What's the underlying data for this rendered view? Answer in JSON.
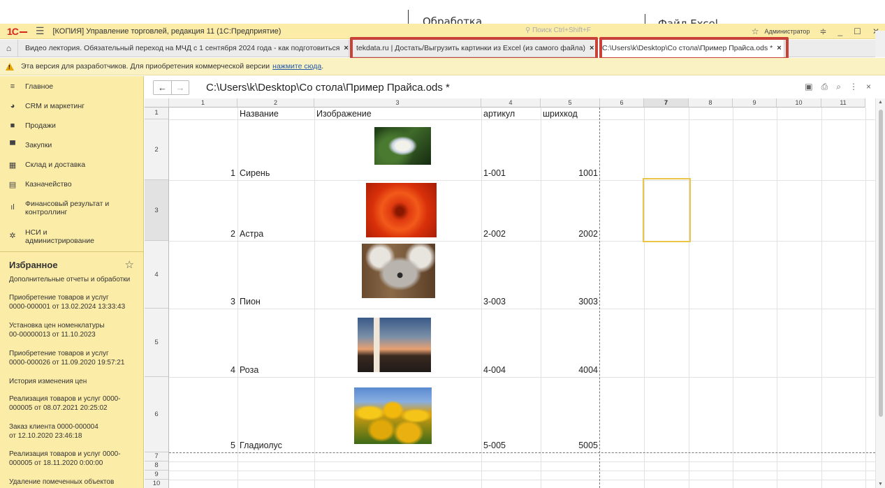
{
  "annotations": {
    "processing": "Обработка",
    "excel_file": "Файл Excel"
  },
  "titlebar": {
    "logo": "1С",
    "title": "[КОПИЯ] Управление торговлей, редакция 11  (1С:Предприятие)",
    "search_placeholder": "Поиск Ctrl+Shift+F",
    "user": "Администратор"
  },
  "tabs": [
    {
      "label": "Видео лектория. Обязательный переход на МЧД с 1 сентября 2024 года - как подготовиться"
    },
    {
      "label": "tekdata.ru | Достать/Выгрузить картинки из Excel (из самого файла)"
    },
    {
      "label": "C:\\Users\\k\\Desktop\\Со стола\\Пример Прайса.ods *"
    }
  ],
  "warning": {
    "text": "Эта версия для разработчиков. Для приобретения коммерческой версии",
    "link": "нажмите сюда",
    "suffix": "."
  },
  "sidebar": {
    "nav": [
      {
        "icon": "menu-icon",
        "label": "Главное"
      },
      {
        "icon": "crm-icon",
        "label": "CRM и маркетинг"
      },
      {
        "icon": "bag-icon",
        "label": "Продажи"
      },
      {
        "icon": "cart-icon",
        "label": "Закупки"
      },
      {
        "icon": "warehouse-icon",
        "label": "Склад и доставка"
      },
      {
        "icon": "treasury-icon",
        "label": "Казначейство"
      },
      {
        "icon": "chart-icon",
        "label": "Финансовый результат и контроллинг"
      },
      {
        "icon": "gear-icon",
        "label": "НСИ и администрирование"
      }
    ],
    "favorites_title": "Избранное",
    "favorites": [
      "Дополнительные отчеты и обработки",
      "Приобретение товаров и услуг 0000-000001 от 13.02.2024 13:33:43",
      "Установка цен номенклатуры 00-00000013 от 11.10.2023",
      "Приобретение товаров и услуг 0000-000026 от 11.09.2020 19:57:21",
      "История изменения цен",
      "Реализация товаров и услуг 0000-000005 от 08.07.2021 20:25:02",
      "Заказ клиента 0000-000004 от 12.10.2020 23:46:18",
      "Реализация товаров и услуг 0000-000005 от 18.11.2020 0:00:00",
      "Удаление помеченных объектов"
    ]
  },
  "document": {
    "title": "C:\\Users\\k\\Desktop\\Со стола\\Пример Прайса.ods *"
  },
  "sheet": {
    "columns": [
      "1",
      "2",
      "3",
      "4",
      "5",
      "6",
      "7",
      "8",
      "9",
      "10",
      "11"
    ],
    "rows": [
      "1",
      "2",
      "3",
      "4",
      "5",
      "6",
      "7",
      "8",
      "9",
      "10"
    ],
    "selected_column": "7",
    "selected_row": "3",
    "headers": {
      "name": "Название",
      "image": "Изображение",
      "article": "артикул",
      "barcode": "шрихкод"
    },
    "items": [
      {
        "num": "1",
        "name": "Сирень",
        "article": "1-001",
        "barcode": "1001",
        "image": "flower-hydrangea"
      },
      {
        "num": "2",
        "name": "Астра",
        "article": "2-002",
        "barcode": "2002",
        "image": "flower-red-chrysanthemum"
      },
      {
        "num": "3",
        "name": "Пион",
        "article": "3-003",
        "barcode": "3003",
        "image": "koala"
      },
      {
        "num": "4",
        "name": "Роза",
        "article": "4-004",
        "barcode": "4004",
        "image": "lighthouse"
      },
      {
        "num": "5",
        "name": "Гладиолус",
        "article": "5-005",
        "barcode": "5005",
        "image": "yellow-tulips"
      }
    ]
  }
}
